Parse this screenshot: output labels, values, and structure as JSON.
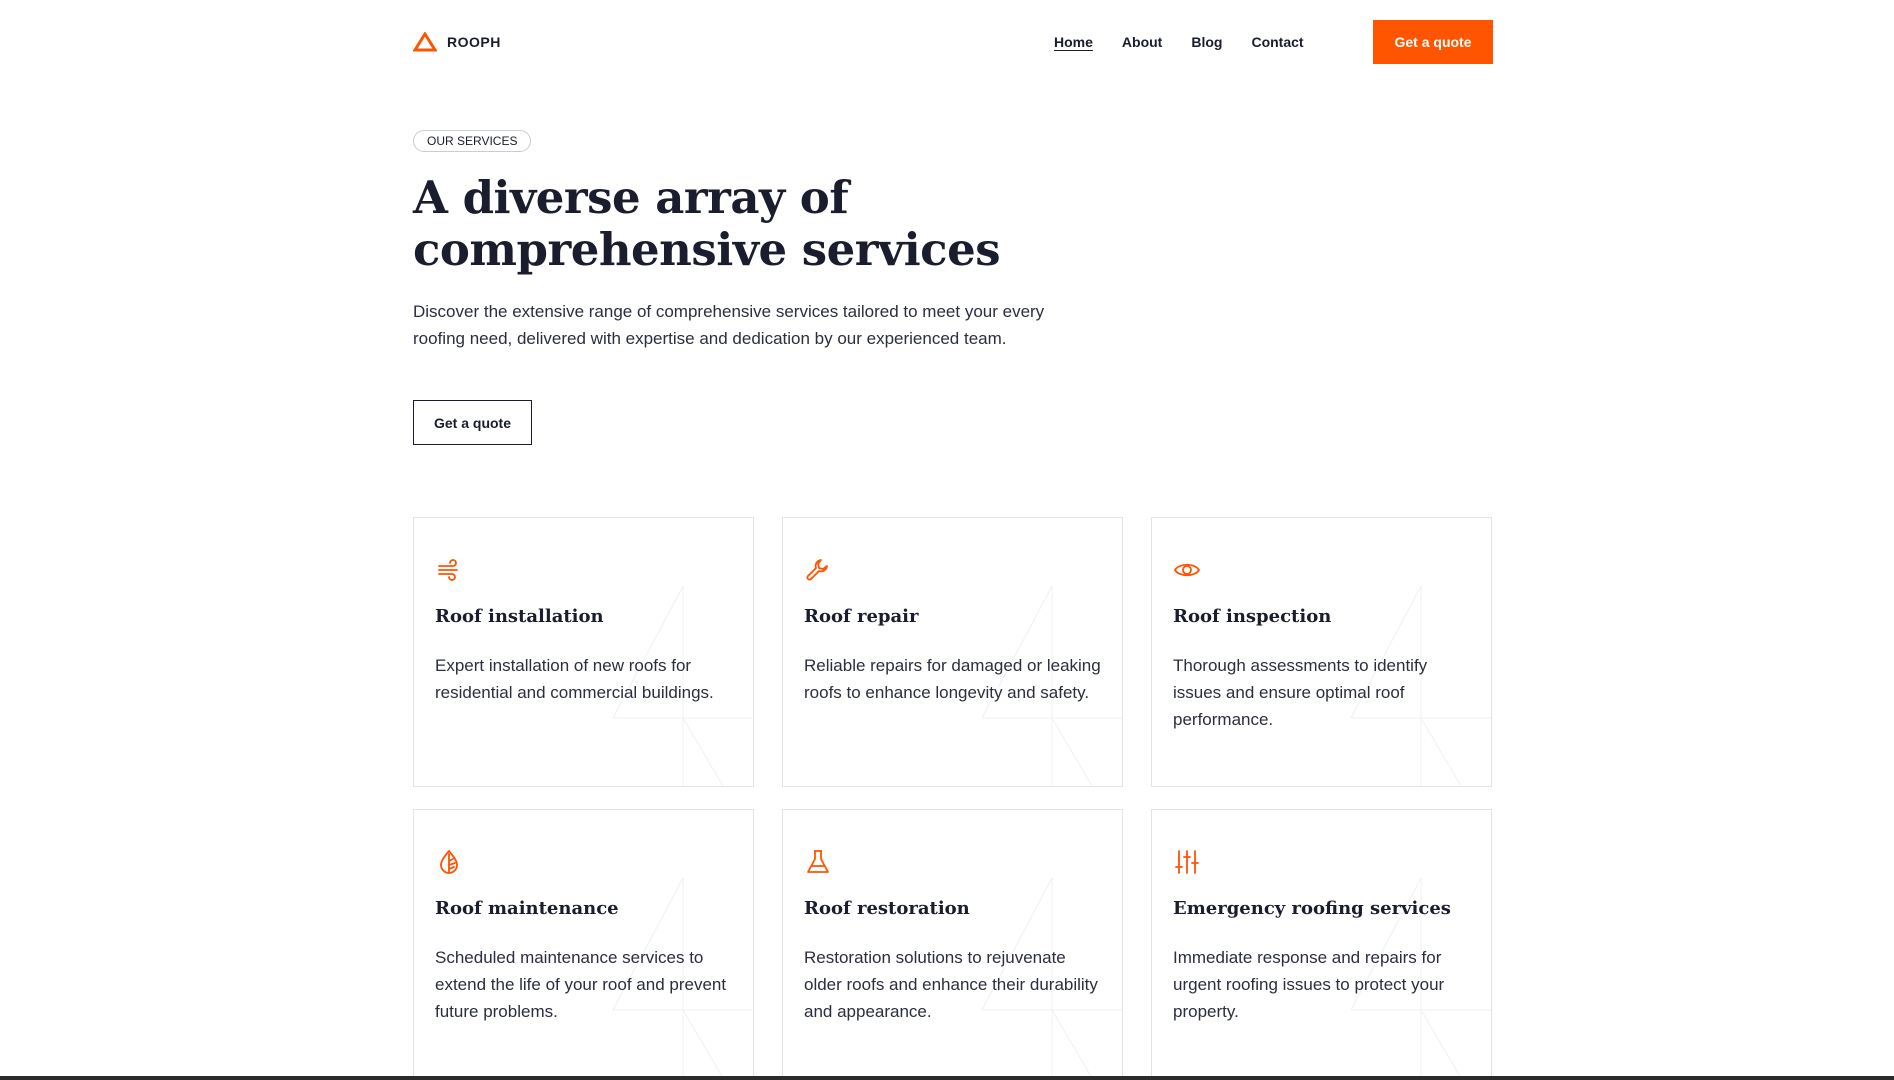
{
  "brand": {
    "name": "ROOPH",
    "accent": "#ff5400",
    "text": "#1a1d2e"
  },
  "nav": {
    "items": [
      {
        "label": "Home",
        "active": true
      },
      {
        "label": "About"
      },
      {
        "label": "Blog"
      },
      {
        "label": "Contact"
      }
    ],
    "cta_label": "Get a quote"
  },
  "hero": {
    "eyebrow": "OUR SERVICES",
    "title_line1": "A diverse array of",
    "title_line2": "comprehensive services",
    "description": "Discover the extensive range of comprehensive services tailored to meet your every roofing need, delivered with expertise and dedication by our experienced team.",
    "button_label": "Get a quote"
  },
  "services": [
    {
      "icon": "wind-icon",
      "title": "Roof installation",
      "description": "Expert installation of new roofs for residential and commercial buildings."
    },
    {
      "icon": "wrench-icon",
      "title": "Roof repair",
      "description": "Reliable repairs for damaged or leaking roofs to enhance longevity and safety."
    },
    {
      "icon": "eye-icon",
      "title": "Roof inspection",
      "description": "Thorough assessments to identify issues and ensure optimal roof performance."
    },
    {
      "icon": "drop-icon",
      "title": "Roof maintenance",
      "description": "Scheduled maintenance services to extend the life of your roof and prevent future problems."
    },
    {
      "icon": "flask-icon",
      "title": "Roof restoration",
      "description": "Restoration solutions to rejuvenate older roofs and enhance their durability and appearance."
    },
    {
      "icon": "sliders-icon",
      "title": "Emergency roofing services",
      "description": "Immediate response and repairs for urgent roofing issues to protect your property."
    }
  ]
}
